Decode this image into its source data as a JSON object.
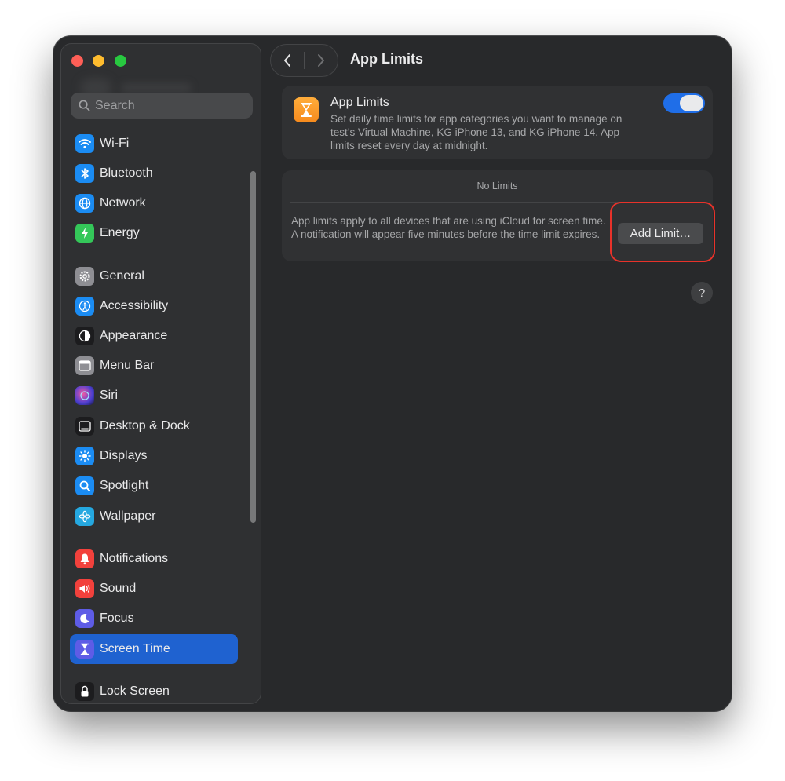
{
  "window": {
    "title": "App Limits"
  },
  "sidebar": {
    "search_placeholder": "Search",
    "items": [
      {
        "label": "Wi-Fi",
        "icon": "wifi-icon",
        "color": "#1b8cf3"
      },
      {
        "label": "Bluetooth",
        "icon": "bluetooth-icon",
        "color": "#1b8cf3"
      },
      {
        "label": "Network",
        "icon": "globe-icon",
        "color": "#1b8cf3"
      },
      {
        "label": "Energy",
        "icon": "bolt-icon",
        "color": "#34c759"
      },
      {
        "label": "General",
        "icon": "gear-icon",
        "color": "#8e8e93"
      },
      {
        "label": "Accessibility",
        "icon": "accessibility-icon",
        "color": "#1b8cf3"
      },
      {
        "label": "Appearance",
        "icon": "appearance-icon",
        "color": "#1c1c1e"
      },
      {
        "label": "Menu Bar",
        "icon": "menubar-icon",
        "color": "#8e8e93"
      },
      {
        "label": "Siri",
        "icon": "siri-icon",
        "color": "#5a3fc0"
      },
      {
        "label": "Desktop & Dock",
        "icon": "dock-icon",
        "color": "#1c1c1e"
      },
      {
        "label": "Displays",
        "icon": "sun-icon",
        "color": "#1b8cf3"
      },
      {
        "label": "Spotlight",
        "icon": "magnifier-icon",
        "color": "#1b8cf3"
      },
      {
        "label": "Wallpaper",
        "icon": "flower-icon",
        "color": "#25a8e0"
      },
      {
        "label": "Notifications",
        "icon": "bell-icon",
        "color": "#f2413c"
      },
      {
        "label": "Sound",
        "icon": "speaker-icon",
        "color": "#f2413c"
      },
      {
        "label": "Focus",
        "icon": "moon-icon",
        "color": "#5e5ce6"
      },
      {
        "label": "Screen Time",
        "icon": "hourglass-icon",
        "color": "#5e5ce6",
        "active": true
      },
      {
        "label": "Lock Screen",
        "icon": "lock-icon",
        "color": "#1c1c1e"
      }
    ]
  },
  "main": {
    "app_limits": {
      "title": "App Limits",
      "description": "Set daily time limits for app categories you want to manage on test’s Virtual Machine, KG iPhone 13, and KG iPhone 14. App limits reset every day at midnight.",
      "toggle_on": true
    },
    "limits": {
      "empty_label": "No Limits",
      "info": "App limits apply to all devices that are using iCloud for screen time. A notification will appear five minutes before the time limit expires.",
      "add_button": "Add Limit…"
    },
    "help_label": "?"
  },
  "colors": {
    "accent": "#1f62d0",
    "highlight": "#e8322a"
  }
}
